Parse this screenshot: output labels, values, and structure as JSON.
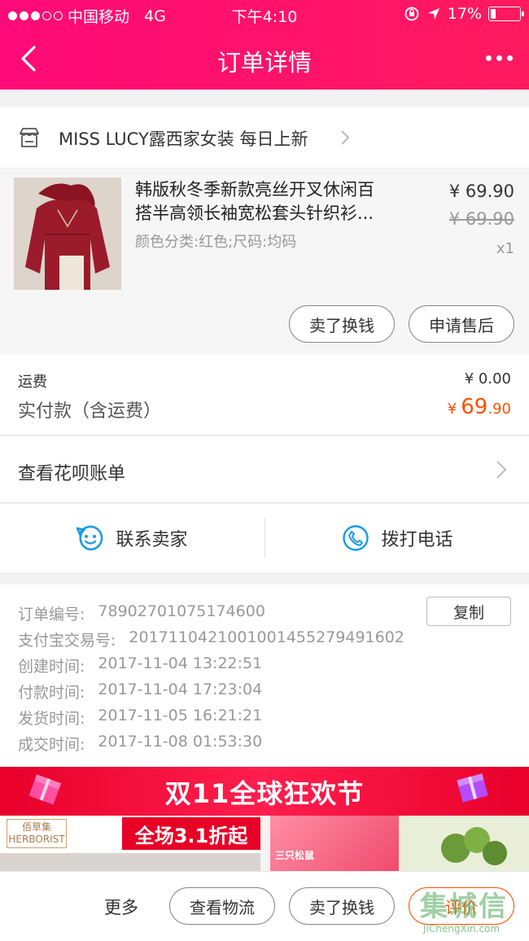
{
  "status_bar": {
    "carrier": "中国移动",
    "network": "4G",
    "time": "下午4:10",
    "battery": "17%",
    "battery_level": 0.17
  },
  "nav": {
    "title": "订单详情"
  },
  "shop": {
    "name": "MISS LUCY露西家女装 每日上新"
  },
  "item": {
    "title_line1": "韩版秋冬季新款亮丝开叉休闲百",
    "title_line2": "搭半高领长袖宽松套头针织衫...",
    "spec": "颜色分类:红色;尺码:均码",
    "price": "¥ 69.90",
    "original_price": "¥ 69.90",
    "quantity": "x1",
    "sell_button": "卖了换钱",
    "aftersale_button": "申请售后"
  },
  "fees": {
    "shipping_label": "运费",
    "shipping_value": "¥ 0.00",
    "paid_label": "实付款（含运费）",
    "paid_symbol": "¥",
    "paid_int": "69",
    "paid_dec": ".90"
  },
  "huabei": {
    "label": "查看花呗账单"
  },
  "contact": {
    "seller_label": "联系卖家",
    "phone_label": "拨打电话"
  },
  "order_info": {
    "copy_button": "复制",
    "rows": [
      {
        "label": "订单编号:",
        "value": "78902701075174600"
      },
      {
        "label": "支付宝交易号:",
        "value": "2017110421001001455279491602"
      },
      {
        "label": "创建时间:",
        "value": "2017-11-04 13:22:51"
      },
      {
        "label": "付款时间:",
        "value": "2017-11-04 17:23:04"
      },
      {
        "label": "发货时间:",
        "value": "2017-11-05 16:21:21"
      },
      {
        "label": "成交时间:",
        "value": "2017-11-08 01:53:30"
      }
    ]
  },
  "banner": {
    "title": "双11全球狂欢节",
    "left_brand": "佰草集 HERBORIST",
    "left_promo": "全场3.1折起",
    "right_brand": "三只松鼠"
  },
  "bottom_bar": {
    "more": "更多",
    "logistics": "查看物流",
    "sell": "卖了换钱",
    "review": "评价"
  },
  "watermark": {
    "text": "集城信",
    "sub": "JiChengXin.com"
  },
  "colors": {
    "header": "#ff0a78",
    "price_accent": "#ff5000",
    "contact_icon": "#1a9be6"
  }
}
